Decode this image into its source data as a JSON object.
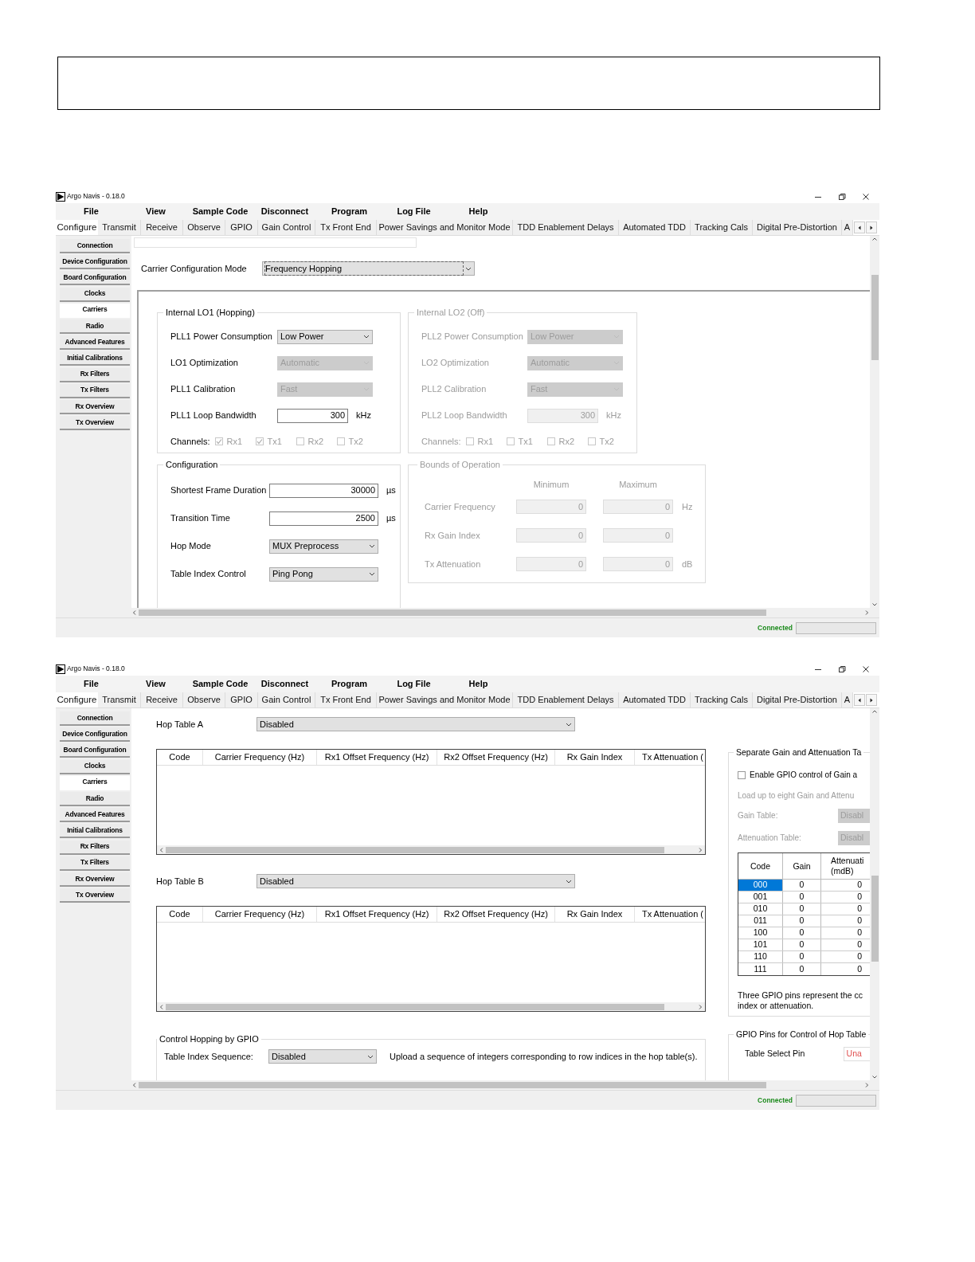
{
  "windows": [
    {
      "title": "Argo Navis - 0.18.0",
      "menu": [
        "File",
        "View",
        "Sample Code",
        "Disconnect",
        "Program",
        "Log File",
        "Help"
      ],
      "tabs": [
        {
          "label": "Configure",
          "selected": true
        },
        {
          "label": "Transmit",
          "selected": false
        },
        {
          "label": "Receive",
          "selected": false
        },
        {
          "label": "Observe",
          "selected": false
        },
        {
          "label": "GPIO",
          "selected": false
        },
        {
          "label": "Gain Control",
          "selected": false
        },
        {
          "label": "Tx Front End",
          "selected": false
        },
        {
          "label": "Power Savings and Monitor Mode",
          "selected": false
        },
        {
          "label": "TDD Enablement Delays",
          "selected": false
        },
        {
          "label": "Automated TDD",
          "selected": false
        },
        {
          "label": "Tracking Cals",
          "selected": false
        },
        {
          "label": "Digital Pre-Distortion",
          "selected": false
        },
        {
          "label": "A",
          "selected": false
        }
      ],
      "sidebar": [
        {
          "label": "Connection",
          "selected": false
        },
        {
          "label": "Device Configuration",
          "selected": false
        },
        {
          "label": "Board Configuration",
          "selected": false
        },
        {
          "label": "Clocks",
          "selected": false
        },
        {
          "label": "Carriers",
          "selected": true
        },
        {
          "label": "Radio",
          "selected": false
        },
        {
          "label": "Advanced Features",
          "selected": false
        },
        {
          "label": "Initial Calibrations",
          "selected": false
        },
        {
          "label": "Rx Filters",
          "selected": false
        },
        {
          "label": "Tx Filters",
          "selected": false
        },
        {
          "label": "Rx Overview",
          "selected": false
        },
        {
          "label": "Tx Overview",
          "selected": false
        }
      ],
      "content": {
        "kind": "carrier_mode",
        "mode": {
          "label": "Carrier Configuration Mode",
          "value": "Frequency Hopping",
          "focused": true
        },
        "lo_groups": [
          {
            "title": "Internal LO1 (Hopping)",
            "disabled": false,
            "fields": [
              {
                "kind": "select",
                "label": "PLL1 Power Consumption",
                "value": "Low Power",
                "disabled": false
              },
              {
                "kind": "select",
                "label": "LO1 Optimization",
                "value": "Automatic",
                "disabled": true
              },
              {
                "kind": "select",
                "label": "PLL1 Calibration",
                "value": "Fast",
                "disabled": true
              },
              {
                "kind": "number",
                "label": "PLL1 Loop Bandwidth",
                "value": "300",
                "unit": "kHz",
                "disabled": false
              }
            ],
            "channels_label": "Channels:",
            "channels": [
              {
                "label": "Rx1",
                "checked": true
              },
              {
                "label": "Tx1",
                "checked": true
              },
              {
                "label": "Rx2",
                "checked": false
              },
              {
                "label": "Tx2",
                "checked": false
              }
            ]
          },
          {
            "title": "Internal LO2 (Off)",
            "disabled": true,
            "fields": [
              {
                "kind": "select",
                "label": "PLL2 Power Consumption",
                "value": "Low Power",
                "disabled": true
              },
              {
                "kind": "select",
                "label": "LO2 Optimization",
                "value": "Automatic",
                "disabled": true
              },
              {
                "kind": "select",
                "label": "PLL2 Calibration",
                "value": "Fast",
                "disabled": true
              },
              {
                "kind": "number",
                "label": "PLL2 Loop Bandwidth",
                "value": "300",
                "unit": "kHz",
                "disabled": true
              }
            ],
            "channels_label": "Channels:",
            "channels": [
              {
                "label": "Rx1",
                "checked": false
              },
              {
                "label": "Tx1",
                "checked": false
              },
              {
                "label": "Rx2",
                "checked": false
              },
              {
                "label": "Tx2",
                "checked": false
              }
            ]
          }
        ],
        "configuration": {
          "title": "Configuration",
          "fields": [
            {
              "kind": "number",
              "label": "Shortest Frame Duration",
              "value": "30000",
              "unit": "µs"
            },
            {
              "kind": "number",
              "label": "Transition Time",
              "value": "2500",
              "unit": "µs"
            },
            {
              "kind": "select",
              "label": "Hop Mode",
              "value": "MUX Preprocess"
            },
            {
              "kind": "select",
              "label": "Table Index Control",
              "value": "Ping Pong"
            }
          ]
        },
        "bounds": {
          "title": "Bounds of Operation",
          "disabled": true,
          "columns": [
            "Minimum",
            "Maximum"
          ],
          "rows": [
            {
              "label": "Carrier Frequency",
              "min": "0",
              "max": "0",
              "unit": "Hz"
            },
            {
              "label": "Rx Gain Index",
              "min": "0",
              "max": "0"
            },
            {
              "label": "Tx Attenuation",
              "min": "0",
              "max": "0",
              "unit": "dB"
            }
          ]
        }
      },
      "status": "Connected"
    },
    {
      "title": "Argo Navis - 0.18.0",
      "menu": [
        "File",
        "View",
        "Sample Code",
        "Disconnect",
        "Program",
        "Log File",
        "Help"
      ],
      "tabs": [
        {
          "label": "Configure",
          "selected": true
        },
        {
          "label": "Transmit",
          "selected": false
        },
        {
          "label": "Receive",
          "selected": false
        },
        {
          "label": "Observe",
          "selected": false
        },
        {
          "label": "GPIO",
          "selected": false
        },
        {
          "label": "Gain Control",
          "selected": false
        },
        {
          "label": "Tx Front End",
          "selected": false
        },
        {
          "label": "Power Savings and Monitor Mode",
          "selected": false
        },
        {
          "label": "TDD Enablement Delays",
          "selected": false
        },
        {
          "label": "Automated TDD",
          "selected": false
        },
        {
          "label": "Tracking Cals",
          "selected": false
        },
        {
          "label": "Digital Pre-Distortion",
          "selected": false
        },
        {
          "label": "A",
          "selected": false
        }
      ],
      "sidebar": [
        {
          "label": "Connection",
          "selected": false
        },
        {
          "label": "Device Configuration",
          "selected": false
        },
        {
          "label": "Board Configuration",
          "selected": false
        },
        {
          "label": "Clocks",
          "selected": false
        },
        {
          "label": "Carriers",
          "selected": true
        },
        {
          "label": "Radio",
          "selected": false
        },
        {
          "label": "Advanced Features",
          "selected": false
        },
        {
          "label": "Initial Calibrations",
          "selected": false
        },
        {
          "label": "Rx Filters",
          "selected": false
        },
        {
          "label": "Tx Filters",
          "selected": false
        },
        {
          "label": "Rx Overview",
          "selected": false
        },
        {
          "label": "Tx Overview",
          "selected": false
        }
      ],
      "content": {
        "kind": "hop_tables",
        "hop_tables": [
          {
            "label": "Hop Table A",
            "value": "Disabled",
            "columns": [
              "Code",
              "Carrier Frequency (Hz)",
              "Rx1 Offset Frequency (Hz)",
              "Rx2 Offset Frequency (Hz)",
              "Rx Gain Index",
              "Tx Attenuation ("
            ]
          },
          {
            "label": "Hop Table B",
            "value": "Disabled",
            "columns": [
              "Code",
              "Carrier Frequency (Hz)",
              "Rx1 Offset Frequency (Hz)",
              "Rx2 Offset Frequency (Hz)",
              "Rx Gain Index",
              "Tx Attenuation ("
            ]
          }
        ],
        "gpio_control": {
          "title": "Control Hopping by GPIO",
          "label": "Table Index Sequence:",
          "value": "Disabled",
          "note": "Upload a sequence of integers corresponding to row indices in the hop table(s)."
        },
        "gain_group": {
          "title": "Separate Gain and Attenuation Ta",
          "checkbox": {
            "label": "Enable GPIO control of Gain a",
            "checked": false
          },
          "hint": "Load up to eight Gain and Attenu",
          "selects": [
            {
              "label": "Gain Table:",
              "value": "Disabl",
              "disabled": true
            },
            {
              "label": "Attenuation Table:",
              "value": "Disabl",
              "disabled": true
            }
          ],
          "columns": [
            "Code",
            "Gain",
            "Attenuati\n(mdB)"
          ],
          "rows": [
            {
              "code": "000",
              "gain": "0",
              "attenuation": "0",
              "selected": true
            },
            {
              "code": "001",
              "gain": "0",
              "attenuation": "0",
              "selected": false
            },
            {
              "code": "010",
              "gain": "0",
              "attenuation": "0",
              "selected": false
            },
            {
              "code": "011",
              "gain": "0",
              "attenuation": "0",
              "selected": false
            },
            {
              "code": "100",
              "gain": "0",
              "attenuation": "0",
              "selected": false
            },
            {
              "code": "101",
              "gain": "0",
              "attenuation": "0",
              "selected": false
            },
            {
              "code": "110",
              "gain": "0",
              "attenuation": "0",
              "selected": false
            },
            {
              "code": "111",
              "gain": "0",
              "attenuation": "0",
              "selected": false
            }
          ],
          "note": "Three GPIO pins represent the cc\nindex or attenuation."
        },
        "gpio_pins": {
          "title": "GPIO Pins for Control of Hop Table",
          "label": "Table Select Pin",
          "value": "Una",
          "warning": true
        }
      },
      "status": "Connected"
    }
  ]
}
